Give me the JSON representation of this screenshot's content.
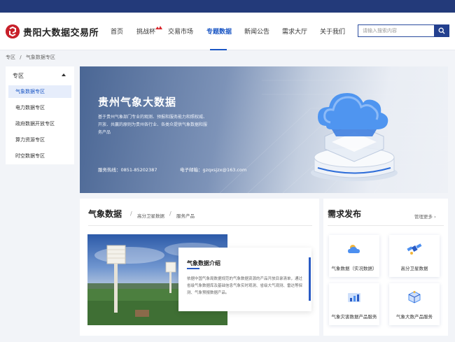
{
  "header": {
    "site_name": "贵阳大数据交易所",
    "nav": [
      {
        "label": "首页"
      },
      {
        "label": "挑战杯"
      },
      {
        "label": "交易市场"
      },
      {
        "label": "专题数据"
      },
      {
        "label": "新闻公告"
      },
      {
        "label": "需求大厅"
      },
      {
        "label": "关于我们"
      }
    ],
    "search_placeholder": "请输入搜索内容"
  },
  "breadcrumb": [
    "专区",
    "/",
    "气象数据专区"
  ],
  "sidebar": {
    "heading": "专区",
    "items": [
      "气象数据专区",
      "电力数据专区",
      "政府数据开放专区",
      "算力资源专区",
      "时空数据专区"
    ],
    "active_index": 0
  },
  "banner": {
    "title": "贵州气象大数据",
    "description": "基于贵州气象部门专业的观测、预报和服务能力和照权威、开放、共赢的原则为贵州各行业、各类众提供气象数据和服务产品",
    "hotline": "服务热线：0851-85202387",
    "email": "电子邮箱：gzqxsjzx@163.com"
  },
  "main": {
    "title": "气象数据",
    "tabs": [
      "高分卫星数据",
      "服务产品"
    ],
    "intro_title": "气象数据介绍",
    "intro_text": "依据中国气象局数据规范的气象数据资源的产品开放目录清单，通过省级气象数据库及基础信息气象实时观测、省级大气观测、雷达等探测、气象预报数据产品。"
  },
  "demand": {
    "title": "需求发布",
    "more": "管理更多",
    "tiles": [
      {
        "label": "气象数据（实况数据）",
        "icon": "weather-icon"
      },
      {
        "label": "高分卫星数据",
        "icon": "satellite-icon"
      },
      {
        "label": "气象灾害数据产品服务",
        "icon": "chart-icon"
      },
      {
        "label": "气象大数产品服务",
        "icon": "cube-icon"
      }
    ]
  },
  "colors": {
    "brand": "#c8202a",
    "accent": "#1a56c4",
    "topbar": "#233a7a"
  }
}
